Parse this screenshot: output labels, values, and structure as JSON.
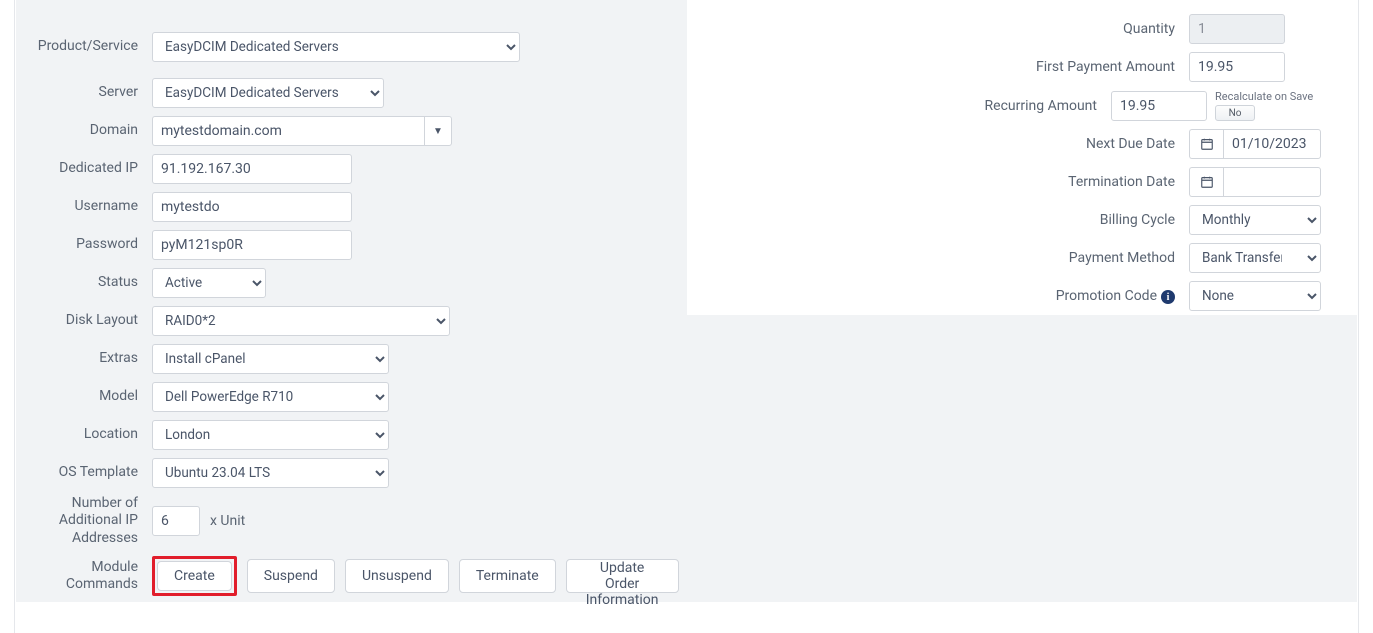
{
  "left": {
    "product_service": {
      "label": "Product/Service",
      "value": "EasyDCIM Dedicated Servers"
    },
    "server": {
      "label": "Server",
      "value": "EasyDCIM Dedicated Servers"
    },
    "domain": {
      "label": "Domain",
      "value": "mytestdomain.com"
    },
    "dedicated_ip": {
      "label": "Dedicated IP",
      "value": "91.192.167.30"
    },
    "username": {
      "label": "Username",
      "value": "mytestdo"
    },
    "password": {
      "label": "Password",
      "value": "pyM121sp0R"
    },
    "status": {
      "label": "Status",
      "value": "Active"
    },
    "disk_layout": {
      "label": "Disk Layout",
      "value": "RAID0*2"
    },
    "extras": {
      "label": "Extras",
      "value": "Install cPanel"
    },
    "model": {
      "label": "Model",
      "value": "Dell PowerEdge R710"
    },
    "location": {
      "label": "Location",
      "value": "London"
    },
    "os_template": {
      "label": "OS Template",
      "value": "Ubuntu 23.04 LTS"
    },
    "additional_ip": {
      "label": "Number of Additional IP Addresses",
      "value": "6",
      "unit": "x Unit"
    },
    "module_commands": {
      "label": "Module Commands"
    }
  },
  "right": {
    "quantity": {
      "label": "Quantity",
      "value": "1"
    },
    "first_payment": {
      "label": "First Payment Amount",
      "value": "19.95"
    },
    "recurring": {
      "label": "Recurring Amount",
      "value": "19.95",
      "recalc_label": "Recalculate on Save",
      "toggle": "No"
    },
    "next_due": {
      "label": "Next Due Date",
      "value": "01/10/2023"
    },
    "termination": {
      "label": "Termination Date",
      "value": ""
    },
    "billing_cycle": {
      "label": "Billing Cycle",
      "value": "Monthly"
    },
    "payment_method": {
      "label": "Payment Method",
      "value": "Bank Transfer"
    },
    "promotion_code": {
      "label": "Promotion Code",
      "value": "None"
    }
  },
  "buttons": {
    "create": "Create",
    "suspend": "Suspend",
    "unsuspend": "Unsuspend",
    "terminate": "Terminate",
    "update_order": "Update Order Information"
  }
}
